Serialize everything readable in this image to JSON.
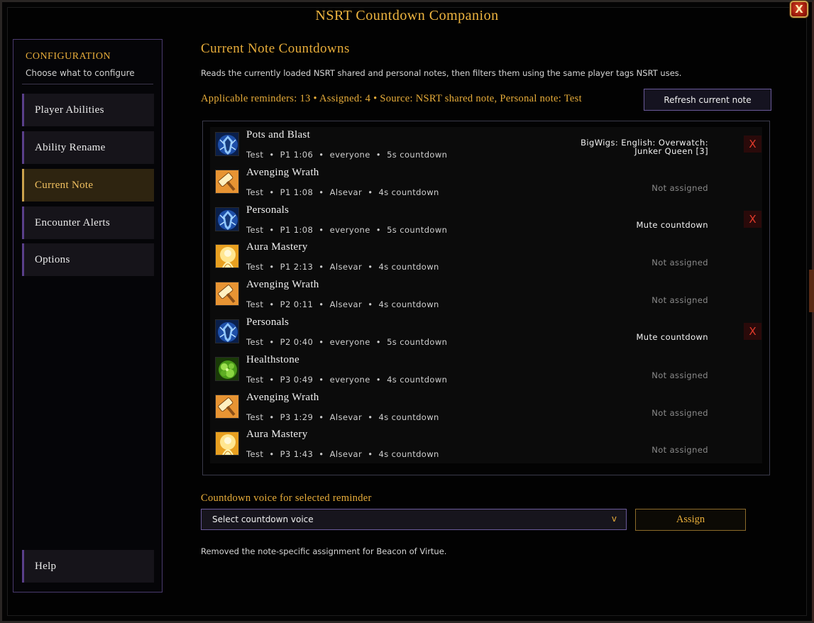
{
  "window": {
    "title": "NSRT Countdown Companion",
    "close_label": "X"
  },
  "sidebar": {
    "heading": "CONFIGURATION",
    "subheading": "Choose what to configure",
    "items": [
      {
        "label": "Player Abilities"
      },
      {
        "label": "Ability Rename"
      },
      {
        "label": "Current Note",
        "active": true
      },
      {
        "label": "Encounter Alerts"
      },
      {
        "label": "Options"
      }
    ],
    "help_label": "Help"
  },
  "main": {
    "title": "Current Note Countdowns",
    "description": "Reads the currently loaded NSRT shared and personal notes, then filters them using the same player tags NSRT uses.",
    "summary": "Applicable reminders: 13  •  Assigned: 4  •  Source: NSRT shared note, Personal note: Test",
    "refresh_label": "Refresh current note",
    "rows": [
      {
        "icon": "shield-rune-icon",
        "name": "Pots and Blast",
        "meta": "Test  •  P1 1:06  •  everyone  •  5s countdown",
        "assignment": "BigWigs: English: Overwatch:\nJunker Queen [3]",
        "assigned": true,
        "remove_label": "X"
      },
      {
        "icon": "hammer-icon",
        "name": "Avenging Wrath",
        "meta": "Test  •  P1 1:08  •  Alsevar  •  4s countdown",
        "assignment": "Not assigned",
        "assigned": false
      },
      {
        "icon": "shield-rune-icon",
        "name": "Personals",
        "meta": "Test  •  P1 1:08  •  everyone  •  5s countdown",
        "assignment": "Mute countdown",
        "assigned": true,
        "remove_label": "X"
      },
      {
        "icon": "aura-icon",
        "name": "Aura Mastery",
        "meta": "Test  •  P1 2:13  •  Alsevar  •  4s countdown",
        "assignment": "Not assigned",
        "assigned": false
      },
      {
        "icon": "hammer-icon",
        "name": "Avenging Wrath",
        "meta": "Test  •  P2 0:11  •  Alsevar  •  4s countdown",
        "assignment": "Not assigned",
        "assigned": false
      },
      {
        "icon": "shield-rune-icon",
        "name": "Personals",
        "meta": "Test  •  P2 0:40  •  everyone  •  5s countdown",
        "assignment": "Mute countdown",
        "assigned": true,
        "remove_label": "X"
      },
      {
        "icon": "healthstone-icon",
        "name": "Healthstone",
        "meta": "Test  •  P3 0:49  •  everyone  •  4s countdown",
        "assignment": "Not assigned",
        "assigned": false
      },
      {
        "icon": "hammer-icon",
        "name": "Avenging Wrath",
        "meta": "Test  •  P3 1:29  •  Alsevar  •  4s countdown",
        "assignment": "Not assigned",
        "assigned": false
      },
      {
        "icon": "aura-icon",
        "name": "Aura Mastery",
        "meta": "Test  •  P3 1:43  •  Alsevar  •  4s countdown",
        "assignment": "Not assigned",
        "assigned": false
      }
    ],
    "voice_label": "Countdown voice for selected reminder",
    "voice_select_value": "Select countdown voice",
    "voice_chevron": "v",
    "assign_label": "Assign",
    "status": "Removed the note-specific assignment for Beacon of Virtue."
  }
}
